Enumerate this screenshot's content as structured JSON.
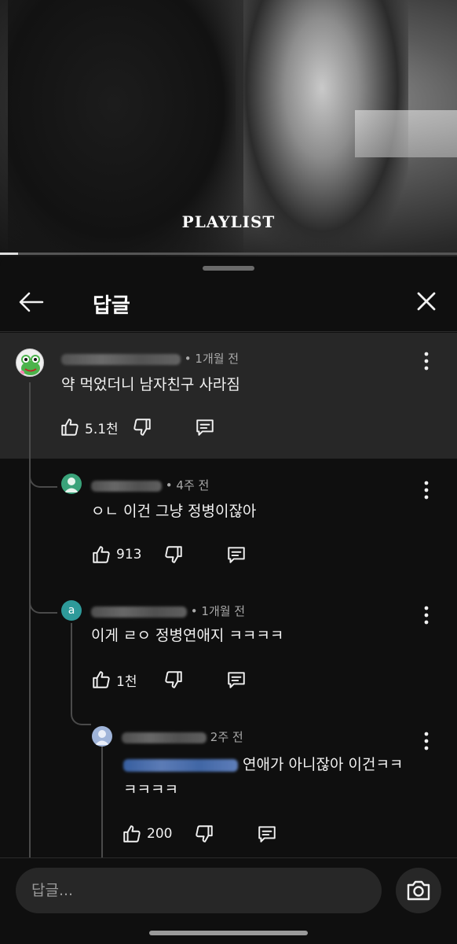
{
  "video": {
    "overlay_text": "PLAYLIST",
    "progress": 0.04
  },
  "header": {
    "title": "답글",
    "back_icon": "arrow-left-icon",
    "close_icon": "close-icon"
  },
  "parent_comment": {
    "time": "• 1개월 전",
    "text": "약 먹었더니 남자친구 사라짐",
    "likes": "5.1천",
    "avatar_icon": "frog-avatar-icon"
  },
  "replies": [
    {
      "time": "• 4주 전",
      "text": "ㅇㄴ 이건 그냥 정병이잖아",
      "likes": "913",
      "avatar_color": "#3aa37a"
    },
    {
      "time": "• 1개월 전",
      "text": "이게 ㄹㅇ 정병연애지 ㅋㅋㅋㅋ",
      "likes": "1천",
      "avatar_letter": "a",
      "avatar_color": "#2e9a9a"
    },
    {
      "time": "2주 전",
      "text_line1": "연애가 아니잖아 이건ㅋㅋ",
      "text_line2": "ㅋㅋㅋㅋ",
      "likes": "200",
      "avatar_color": "#9fb4d9"
    }
  ],
  "input": {
    "placeholder": "답글..."
  },
  "icons": {
    "like": "thumbs-up-icon",
    "dislike": "thumbs-down-icon",
    "reply": "comment-icon",
    "more": "more-vert-icon",
    "camera": "camera-icon"
  }
}
